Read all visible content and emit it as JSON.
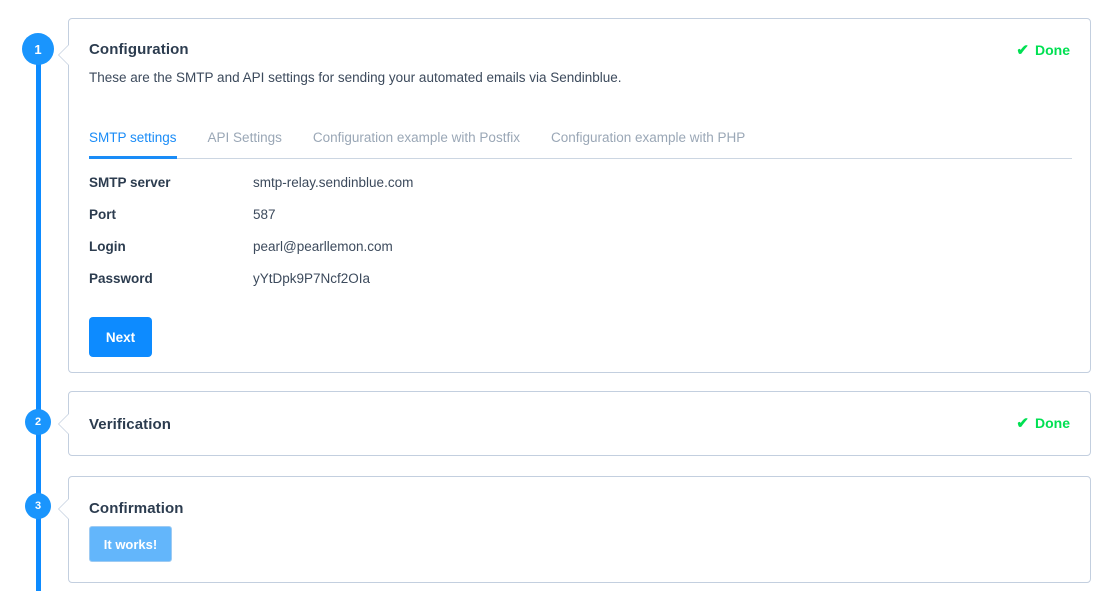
{
  "steps": [
    {
      "number": "1"
    },
    {
      "number": "2"
    },
    {
      "number": "3"
    }
  ],
  "configuration": {
    "title": "Configuration",
    "description": "These are the SMTP and API settings for sending your automated emails via Sendinblue.",
    "status": {
      "label": "Done",
      "icon": "check-icon",
      "color": "#00e052"
    },
    "tabs": [
      {
        "label": "SMTP settings",
        "active": true
      },
      {
        "label": "API Settings",
        "active": false
      },
      {
        "label": "Configuration example with Postfix",
        "active": false
      },
      {
        "label": "Configuration example with PHP",
        "active": false
      }
    ],
    "settings": [
      {
        "label": "SMTP server",
        "value": "smtp-relay.sendinblue.com"
      },
      {
        "label": "Port",
        "value": "587"
      },
      {
        "label": "Login",
        "value": "pearl@pearllemon.com"
      },
      {
        "label": "Password",
        "value": "yYtDpk9P7Ncf2OIa"
      }
    ],
    "next_button": "Next"
  },
  "verification": {
    "title": "Verification",
    "status": {
      "label": "Done",
      "icon": "check-icon",
      "color": "#00e052"
    }
  },
  "confirmation": {
    "title": "Confirmation",
    "button_label": "It works!"
  },
  "colors": {
    "accent_blue": "#0d8bff",
    "step_blue": "#1a95fd",
    "success_green": "#00e052",
    "card_border": "#c3cfdf",
    "tab_active": "#1a8cf7",
    "tab_inactive": "#9aa7b6",
    "text_dark": "#2c3c4f",
    "itworks_blue": "#63b6fb"
  }
}
